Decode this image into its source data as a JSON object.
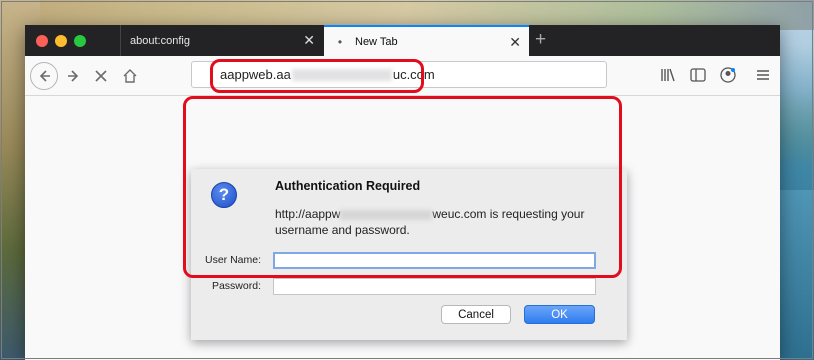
{
  "browser": {
    "tabs": [
      {
        "label": "about:config",
        "close": "✕",
        "active": false
      },
      {
        "label": "New Tab",
        "close": "✕",
        "active": true
      }
    ],
    "new_tab_label": "+",
    "urlbar": {
      "prefix": "aappweb.aa",
      "suffix": "uc.com"
    }
  },
  "dialog": {
    "title": "Authentication Required",
    "message_prefix": "http://aappw",
    "message_suffix": "weuc.com is requesting your username and password.",
    "icon": "?",
    "username_label": "User Name:",
    "username_value": "",
    "password_label": "Password:",
    "password_value": "",
    "cancel_label": "Cancel",
    "ok_label": "OK"
  },
  "colors": {
    "annotation": "#e10d1d",
    "accent": "#0a84ff",
    "ok_button": "#2f7cf0"
  }
}
